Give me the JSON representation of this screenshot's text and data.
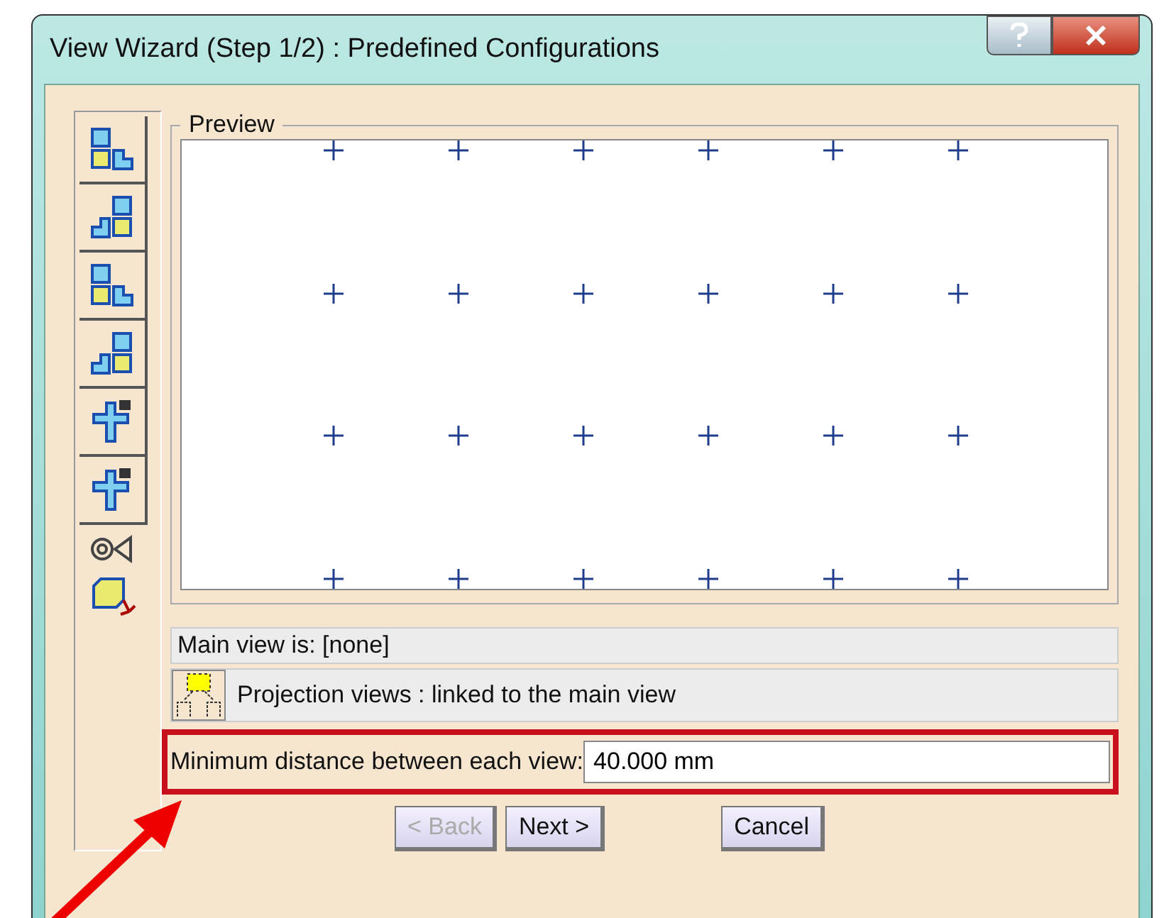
{
  "window": {
    "title": "View Wizard (Step 1/2) : Predefined Configurations"
  },
  "preview": {
    "label": "Preview"
  },
  "main_view": {
    "text": "Main view is: [none]"
  },
  "projection": {
    "text": "Projection views : linked to the main view"
  },
  "distance": {
    "label": "Minimum distance between each view:",
    "value": "40.000 mm"
  },
  "buttons": [
    {
      "label": "< Back",
      "disabled": true
    },
    {
      "label": "Next >",
      "disabled": false
    },
    {
      "label": "Cancel",
      "disabled": false
    }
  ]
}
